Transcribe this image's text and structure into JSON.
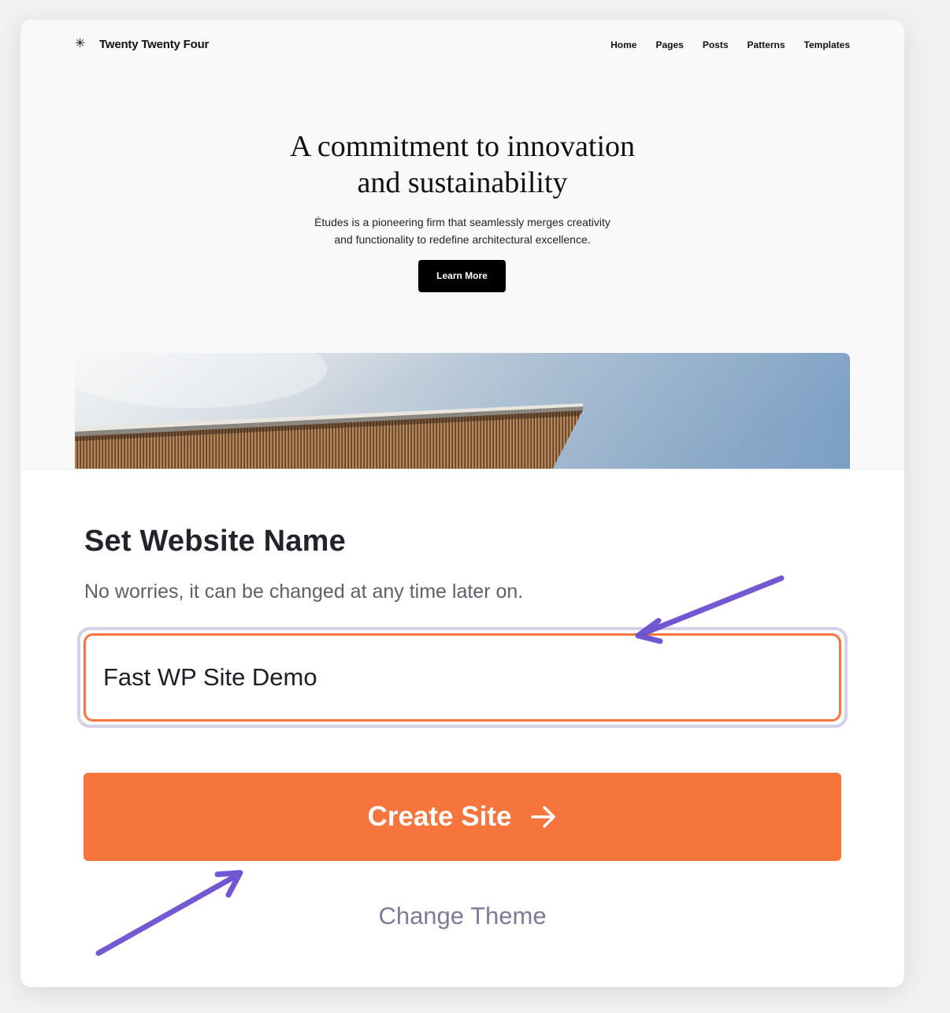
{
  "preview": {
    "site_title": "Twenty Twenty Four",
    "logo_icon": "asterisk-icon",
    "nav": [
      "Home",
      "Pages",
      "Posts",
      "Patterns",
      "Templates"
    ],
    "hero_title_line1": "A commitment to innovation",
    "hero_title_line2": "and sustainability",
    "hero_sub_line1": "Études is a pioneering firm that seamlessly merges creativity",
    "hero_sub_line2": "and functionality to redefine architectural excellence.",
    "learn_more": "Learn More"
  },
  "form": {
    "title": "Set Website Name",
    "subtitle": "No worries, it can be changed at any time later on.",
    "site_name_value": "Fast WP Site Demo",
    "create_label": "Create Site",
    "create_icon": "arrow-right-icon",
    "change_theme": "Change Theme"
  },
  "colors": {
    "accent": "#f5753d",
    "annotation_arrow": "#6b4fd0",
    "focus_ring": "#d4d0e6",
    "link": "#7d7b99"
  }
}
